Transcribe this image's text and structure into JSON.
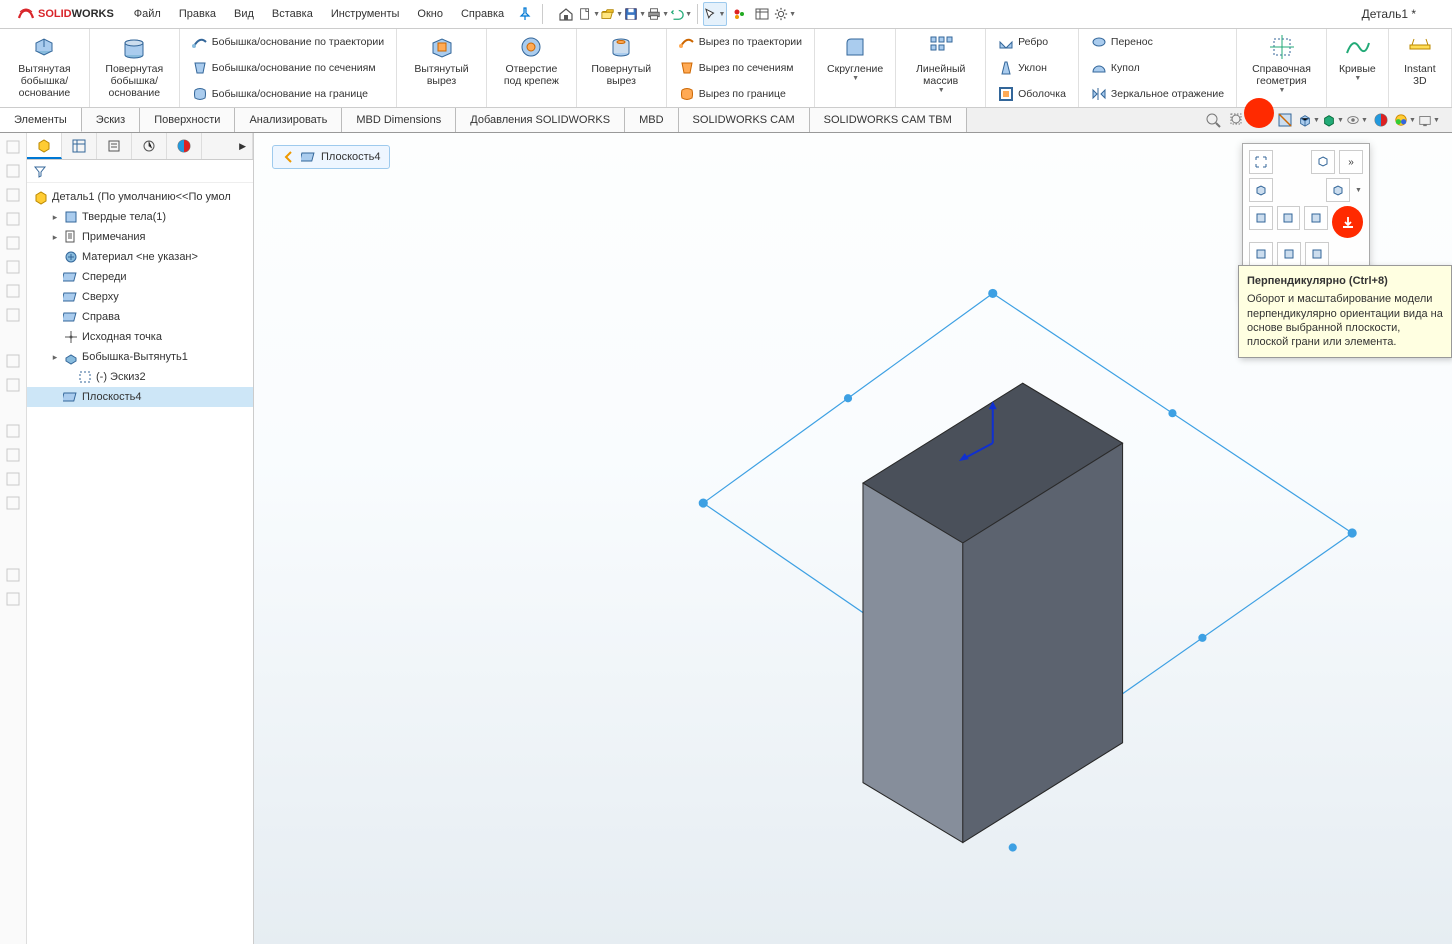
{
  "app": {
    "title": "Деталь1 *"
  },
  "logo": {
    "brand1": "SOLID",
    "brand2": "WORKS"
  },
  "menu": [
    "Файл",
    "Правка",
    "Вид",
    "Вставка",
    "Инструменты",
    "Окно",
    "Справка"
  ],
  "ribbon": {
    "extrude": "Вытянутая бобышка/основание",
    "revolve": "Повернутая бобышка/основание",
    "sweep": "Бобышка/основание по траектории",
    "loft": "Бобышка/основание по сечениям",
    "boundary": "Бобышка/основание на границе",
    "extCut": "Вытянутый вырез",
    "holeWiz": "Отверстие под крепеж",
    "revCut": "Повернутый вырез",
    "sweepCut": "Вырез по траектории",
    "loftCut": "Вырез по сечениям",
    "boundCut": "Вырез по границе",
    "fillet": "Скругление",
    "linPat": "Линейный массив",
    "rib": "Ребро",
    "draft": "Уклон",
    "shell": "Оболочка",
    "wrap": "Перенос",
    "dome": "Купол",
    "mirror": "Зеркальное отражение",
    "refGeo": "Справочная геометрия",
    "curves": "Кривые",
    "instant": "Instant 3D"
  },
  "tabs": [
    "Элементы",
    "Эскиз",
    "Поверхности",
    "Анализировать",
    "MBD Dimensions",
    "Добавления SOLIDWORKS",
    "MBD",
    "SOLIDWORKS CAM",
    "SOLIDWORKS CAM TBM"
  ],
  "tree": {
    "root": "Деталь1  (По умолчанию<<По умол",
    "items": [
      {
        "label": "Твердые тела(1)",
        "indent": 1,
        "exp": "▸",
        "icon": "solidbody"
      },
      {
        "label": "Примечания",
        "indent": 1,
        "exp": "▸",
        "icon": "annotations"
      },
      {
        "label": "Материал <не указан>",
        "indent": 1,
        "exp": "",
        "icon": "material"
      },
      {
        "label": "Спереди",
        "indent": 1,
        "exp": "",
        "icon": "plane"
      },
      {
        "label": "Сверху",
        "indent": 1,
        "exp": "",
        "icon": "plane"
      },
      {
        "label": "Справа",
        "indent": 1,
        "exp": "",
        "icon": "plane"
      },
      {
        "label": "Исходная точка",
        "indent": 1,
        "exp": "",
        "icon": "origin"
      },
      {
        "label": "Бобышка-Вытянуть1",
        "indent": 1,
        "exp": "▸",
        "icon": "extrude"
      },
      {
        "label": "(-) Эскиз2",
        "indent": 2,
        "exp": "",
        "icon": "sketch"
      },
      {
        "label": "Плоскость4",
        "indent": 1,
        "exp": "",
        "icon": "plane",
        "selected": true
      }
    ]
  },
  "breadcrumb": {
    "label": "Плоскость4"
  },
  "tooltip": {
    "title": "Перпендикулярно   (Ctrl+8)",
    "body": "Оборот и масштабирование модели перпендикулярно ориентации вида на основе выбранной плоскости, плоской грани или элемента."
  }
}
